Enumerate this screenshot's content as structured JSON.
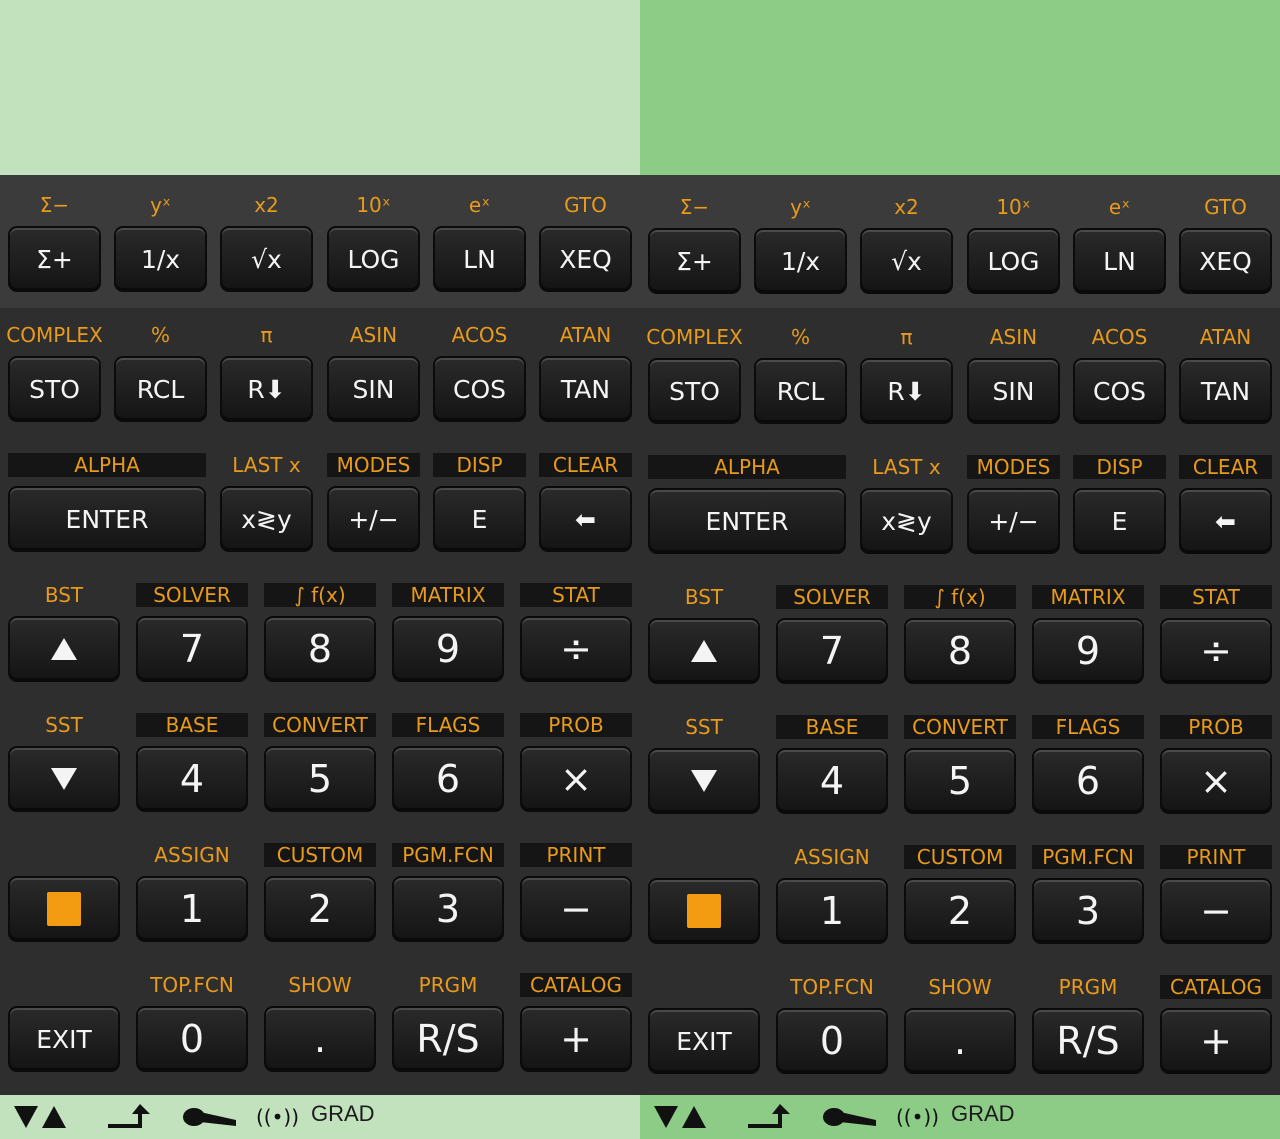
{
  "rows": [
    {
      "labels": [
        "Σ−",
        "yˣ",
        "x2",
        "10ˣ",
        "eˣ",
        "GTO"
      ],
      "keys": [
        "Σ+",
        "1/x",
        "√x",
        "LOG",
        "LN",
        "XEQ"
      ]
    },
    {
      "labels": [
        "COMPLEX",
        "%",
        "π",
        "ASIN",
        "ACOS",
        "ATAN"
      ],
      "keys": [
        "STO",
        "RCL",
        "R⬇",
        "SIN",
        "COS",
        "TAN"
      ]
    },
    {
      "labels": [
        "ALPHA",
        "LAST x",
        "MODES",
        "DISP",
        "CLEAR"
      ],
      "keys": [
        "ENTER",
        "x≷y",
        "+/−",
        "E",
        "⬅"
      ]
    },
    {
      "labels": [
        "BST",
        "SOLVER",
        "∫ f(x)",
        "MATRIX",
        "STAT"
      ],
      "keys": [
        "▲",
        "7",
        "8",
        "9",
        "÷"
      ]
    },
    {
      "labels": [
        "SST",
        "BASE",
        "CONVERT",
        "FLAGS",
        "PROB"
      ],
      "keys": [
        "▼",
        "4",
        "5",
        "6",
        "×"
      ]
    },
    {
      "labels": [
        "",
        "ASSIGN",
        "CUSTOM",
        "PGM.FCN",
        "PRINT"
      ],
      "keys": [
        "shift",
        "1",
        "2",
        "3",
        "−"
      ]
    },
    {
      "labels": [
        "",
        "TOP.FCN",
        "SHOW",
        "PRGM",
        "CATALOG"
      ],
      "keys": [
        "EXIT",
        "0",
        ".",
        "R/S",
        "+"
      ]
    }
  ],
  "status": {
    "angle_mode": "GRAD",
    "icons": [
      "updown-arrows-icon",
      "shift-arrow-icon",
      "print-icon",
      "random-icon"
    ],
    "random_symbol": "((•))"
  },
  "colors": {
    "display_left": "#c1e2bd",
    "display_right": "#8dcc86",
    "function_label": "#e89a1a",
    "shift_key": "#f39c12"
  }
}
